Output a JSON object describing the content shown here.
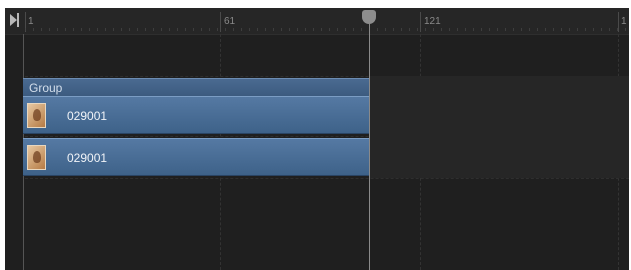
{
  "ruler": {
    "labels": [
      "1",
      "61",
      "121",
      "1"
    ]
  },
  "group": {
    "label": "Group"
  },
  "layers": [
    {
      "label": "029001",
      "thumbnail_icon": "photo-thumbnail-icon"
    },
    {
      "label": "029001",
      "thumbnail_icon": "photo-thumbnail-icon"
    }
  ],
  "colors": {
    "background": "#1f1f1f",
    "layer_bar": "#4a6d96",
    "group_header": "#3b5a7e",
    "playhead": "#8d8d8d"
  }
}
